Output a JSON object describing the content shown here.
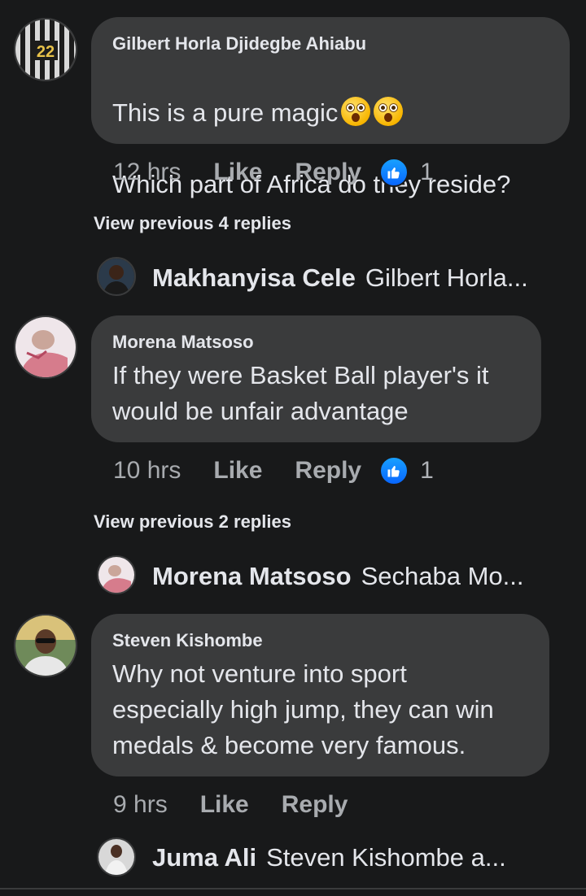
{
  "comments": [
    {
      "author": "Gilbert Horla Djidegbe Ahiabu",
      "line1": "This is a pure magic",
      "line2": "Which part of Africa do they reside?",
      "time": "12 hrs",
      "like_label": "Like",
      "reply_label": "Reply",
      "reaction_count": "1",
      "avatar_text": "22",
      "view_previous": "View previous 4 replies",
      "reply_preview": {
        "name": "Makhanyisa Cele",
        "text": "Gilbert Horla..."
      }
    },
    {
      "author": "Morena Matsoso",
      "text": "If they were Basket Ball player's it\nwould be unfair advantage",
      "time": "10 hrs",
      "like_label": "Like",
      "reply_label": "Reply",
      "reaction_count": "1",
      "view_previous": "View previous 2 replies",
      "reply_preview": {
        "name": "Morena Matsoso",
        "text": "Sechaba Mo..."
      }
    },
    {
      "author": "Steven Kishombe",
      "text": "Why not venture into sport\nespecially high jump, they can win\nmedals & become very famous.",
      "time": "9 hrs",
      "like_label": "Like",
      "reply_label": "Reply",
      "reply_preview": {
        "name": "Juma Ali",
        "text": "Steven Kishombe a..."
      }
    }
  ],
  "icons": {
    "emoji": "flushed-face-icon",
    "reaction": "like-reaction-icon"
  },
  "colors": {
    "background": "#18191a",
    "bubble": "#3a3b3c",
    "like_blue": "#0866ff",
    "muted_text": "#a8abaf"
  }
}
